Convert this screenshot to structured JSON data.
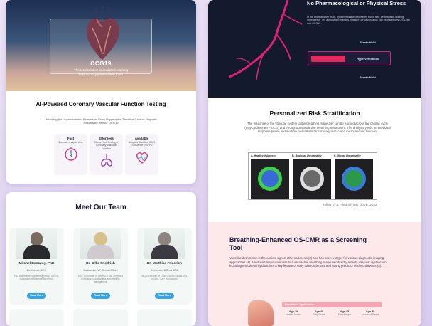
{
  "hero": {
    "title": "OCG19",
    "subtitle": "The total solution to analyze breathing induced OxygenSensitive CMR"
  },
  "intro": {
    "heading": "AI-Powered Coronary Vascular Function Testing",
    "subheading": "Unlocking the Unprecedented Biomarkers From Oxygenation Sensitive Cardiac Magnetic Resonance with AI: OCG19"
  },
  "features": [
    {
      "title": "Fast",
      "desc": "3 minute analysis time"
    },
    {
      "title": "Effortless",
      "desc": "Stress Free Testing of Coronary Vascular Function"
    },
    {
      "title": "Available",
      "desc": "Adopted Standard CMR Sequence (SSFP)"
    }
  ],
  "team": {
    "heading": "Meet Our Team",
    "button_label": "Read More",
    "members": [
      {
        "name": "Mitchel Benovoy, PhD",
        "role": "Co-founder, CEO",
        "bio": "PhD Biomedical Engineering (McGill & ÉTS). Successful medtech entrepreneur."
      },
      {
        "name": "Dr. Silke Friedrich",
        "role": "Co-founder, VP Clinical Affairs",
        "bio": "MSc, co-founder of Circle CVI Inc. 30+ years in medical R&D business and research management."
      },
      {
        "name": "Dr. Matthias Friedrich",
        "role": "Co-founder & Chair CSO",
        "bio": "MD, co-founder of Circle CVI Inc. Global KOL in CMR, 300+ publications."
      }
    ]
  },
  "dark_panel": {
    "title": "No Pharmacological or Physical Stress",
    "text": "In the heart and the brain, hyperventilation decreases blood flow, while breath-holding increases it. The associated changes in tissue (de)oxygenation can be tracked by OS-CMR and OCG19.",
    "breath_hold_label": "Breath Hold",
    "hyperventilation_label": "Hyperventilation"
  },
  "risk": {
    "heading": "Personalized Risk Stratification",
    "text": "The response of the vascular system to the breathing maneuver can be tracked across the cardiac cycle (OxyCardioGram – OCG) and throughout vasoactive breathing maneuvers. The analysis yields an individual response profile and multiple biomarkers for coronary macro and microvascular function.",
    "panels": [
      "A. Healthy Volunteer",
      "B. Regional Abnormality",
      "C. Global Abnormality"
    ],
    "citation": "Hillier E. & Friedrich MG. JoVE, 2022"
  },
  "screening": {
    "heading": "Breathing-Enhanced OS-CMR as a Screening Tool",
    "text": "Vascular dysfunction is the earliest sign of atherosclerosis (3) and has been a target for various diagnostic imaging approaches (4). A reduced responsiveness to a vasoactive breathing maneuver directly reflects vascular dysfunction, including endothelial dysfunction, a key feature of early atherosclerosis and strong predictor of clinical events (5).",
    "bar_label": "Endothelial Dysfunction",
    "stages": [
      {
        "age": "Age 20",
        "label": "Healthy Vessel"
      },
      {
        "age": "Age 40",
        "label": "Fatty Streak"
      },
      {
        "age": "Age 45",
        "label": "Early Plaque"
      },
      {
        "age": "Age 50",
        "label": "Advanced Plaque"
      }
    ]
  },
  "colors": {
    "accent": "#3ba3dc",
    "dark": "#141a2e",
    "magenta": "#e0207a",
    "pink_bg": "#fde8ea"
  }
}
